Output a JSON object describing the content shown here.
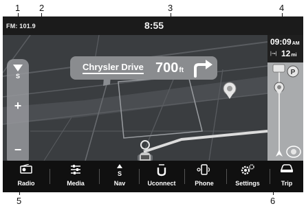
{
  "callouts": [
    "1",
    "2",
    "3",
    "4",
    "5",
    "6"
  ],
  "status_bar": {
    "radio": "FM: 101.9",
    "time": "8:55"
  },
  "turn": {
    "street": "Chrysler Drive",
    "distance": "700",
    "unit": "ft",
    "icon": "turn-right-arrow-icon"
  },
  "zoom": {
    "compass": "S",
    "plus": "+",
    "minus": "−"
  },
  "options": {
    "label": "···"
  },
  "eta": {
    "time": "09:09",
    "ampm": "AM",
    "distance": "12",
    "distance_unit": "mi"
  },
  "colors": {
    "status_bar": "#1b1b1b",
    "map_background": "#3a3d40",
    "nav_bar": "#101010",
    "route_line": "#dcdcdc"
  },
  "nav": [
    {
      "label": "Radio",
      "icon": "radio-icon"
    },
    {
      "label": "Media",
      "icon": "media-icon"
    },
    {
      "label": "Nav",
      "icon": "nav-icon"
    },
    {
      "label": "Uconnect",
      "icon": "uconnect-icon"
    },
    {
      "label": "Phone",
      "icon": "phone-icon"
    },
    {
      "label": "Settings",
      "icon": "settings-icon"
    },
    {
      "label": "Trip",
      "icon": "trip-icon"
    }
  ]
}
